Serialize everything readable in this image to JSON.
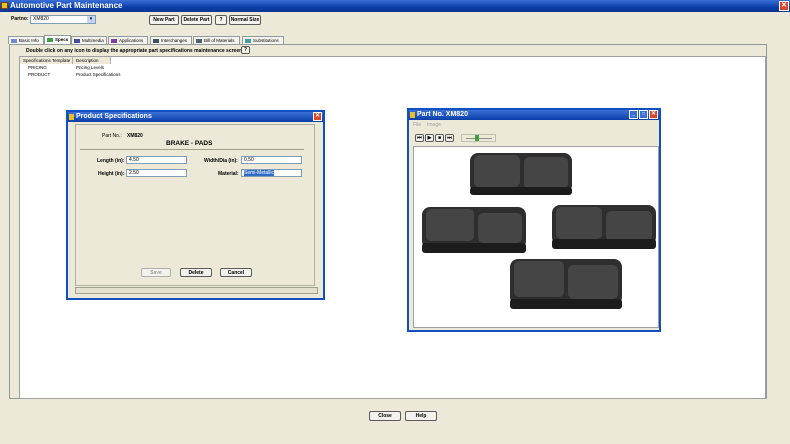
{
  "app": {
    "title": "Automotive Part Maintenance"
  },
  "toolbar": {
    "partno_label": "Partno:",
    "partno_value": "XM820",
    "new_part": "New Part",
    "delete_part": "Delete Part",
    "normal_size": "Normal Size"
  },
  "tabs": [
    "Basic Info",
    "Specs",
    "Multimedia",
    "Applications",
    "Interchanges",
    "Bill of Materials",
    "Substitutions"
  ],
  "specs_hint": "Double click on any icon to display the appropriate part specifications maintenance screen",
  "spec_list": {
    "headers": [
      "Specifications Template",
      "Description"
    ],
    "rows": [
      [
        "PRICING",
        "Pricing Levels"
      ],
      [
        "PRODUCT",
        "Product Specifications"
      ]
    ]
  },
  "product_spec": {
    "title": "Product Specifications",
    "partno_label": "Part No.:",
    "partno_value": "XM820",
    "category": "BRAKE - PADS",
    "length_label": "Length (in):",
    "length_value": "4.50",
    "width_label": "Width/Dia (in):",
    "width_value": "0.50",
    "height_label": "Height (in):",
    "height_value": "2.50",
    "material_label": "Material:",
    "material_value": "Semi-Metallic",
    "save": "Save",
    "delete": "Delete",
    "cancel": "Cancel"
  },
  "image_win": {
    "title": "Part No. XM820",
    "menu": [
      "File",
      "Image"
    ]
  },
  "footer": {
    "close": "Close",
    "help": "Help"
  }
}
